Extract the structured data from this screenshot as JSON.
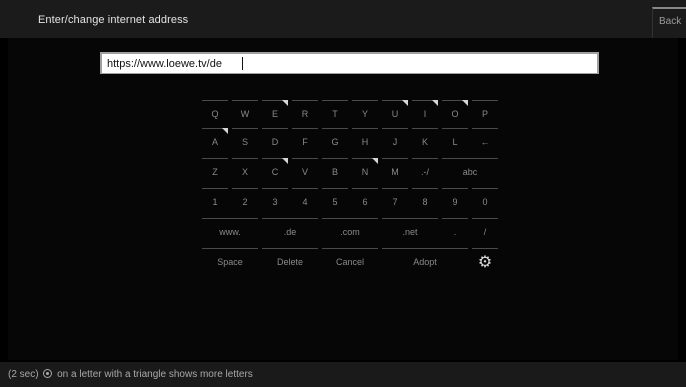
{
  "header": {
    "title": "Enter/change internet address",
    "back_label": "Back"
  },
  "url_field": {
    "value": "https://www.loewe.tv/de"
  },
  "keyboard": {
    "rows": [
      [
        {
          "label": "Q"
        },
        {
          "label": "W"
        },
        {
          "label": "E",
          "more": true
        },
        {
          "label": "R"
        },
        {
          "label": "T"
        },
        {
          "label": "Y"
        },
        {
          "label": "U",
          "more": true
        },
        {
          "label": "I",
          "more": true
        },
        {
          "label": "O",
          "more": true
        },
        {
          "label": "P"
        }
      ],
      [
        {
          "label": "A",
          "more": true
        },
        {
          "label": "S"
        },
        {
          "label": "D"
        },
        {
          "label": "F"
        },
        {
          "label": "G"
        },
        {
          "label": "H"
        },
        {
          "label": "J"
        },
        {
          "label": "K"
        },
        {
          "label": "L"
        },
        {
          "label": "←"
        }
      ],
      [
        {
          "label": "Z"
        },
        {
          "label": "X"
        },
        {
          "label": "C",
          "more": true
        },
        {
          "label": "V"
        },
        {
          "label": "B"
        },
        {
          "label": "N",
          "more": true
        },
        {
          "label": "M"
        },
        {
          "label": ".-/"
        },
        {
          "label": "abc"
        }
      ],
      [
        {
          "label": "1"
        },
        {
          "label": "2"
        },
        {
          "label": "3"
        },
        {
          "label": "4"
        },
        {
          "label": "5"
        },
        {
          "label": "6"
        },
        {
          "label": "7"
        },
        {
          "label": "8"
        },
        {
          "label": "9"
        },
        {
          "label": "0"
        }
      ],
      [
        {
          "label": "www."
        },
        {
          "label": ".de"
        },
        {
          "label": ".com"
        },
        {
          "label": ".net"
        },
        {
          "label": "."
        },
        {
          "label": "/"
        }
      ],
      [
        {
          "label": "Space"
        },
        {
          "label": "Delete"
        },
        {
          "label": "Cancel"
        },
        {
          "label": "Adopt"
        },
        {
          "icon": "gear-icon"
        }
      ]
    ]
  },
  "footer": {
    "prefix": "(2 sec)",
    "icon": "ok-button-icon",
    "suffix": "on a letter with a triangle shows more letters"
  },
  "colors": {
    "background": "#000000",
    "bar": "#1b1b1b",
    "key_text": "#8a8a8a",
    "url_field_bg": "#ffffff"
  }
}
